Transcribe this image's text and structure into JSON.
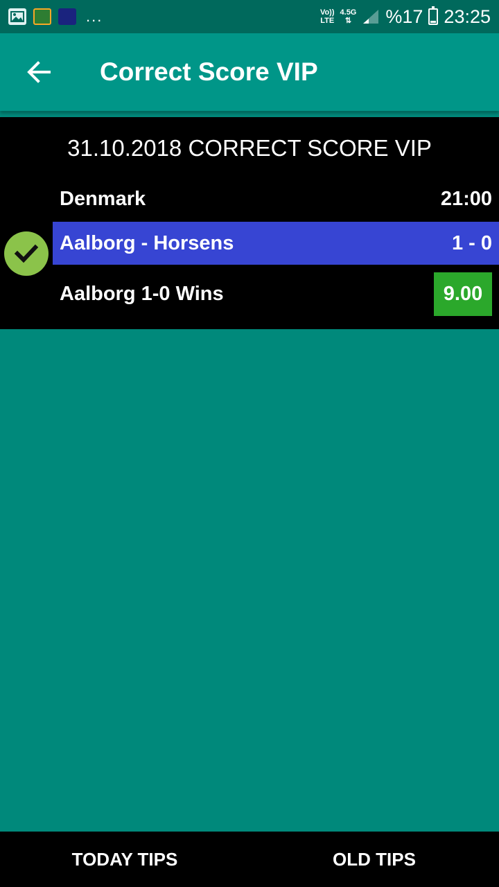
{
  "status_bar": {
    "more_indicator": "...",
    "volte_top": "Vo))",
    "volte_bottom": "LTE",
    "network_top": "4.5G",
    "network_bottom": "⇅",
    "battery_percent": "%17",
    "battery_level": 0.17,
    "time": "23:25"
  },
  "app_bar": {
    "title": "Correct Score VIP",
    "back_icon": "arrow-left-icon"
  },
  "tip": {
    "heading": "31.10.2018 CORRECT SCORE VIP",
    "league": "Denmark",
    "kickoff": "21:00",
    "match": "Aalborg - Horsens",
    "score": "1 - 0",
    "pick": "Aalborg 1-0 Wins",
    "odds": "9.00",
    "result_icon": "check-icon"
  },
  "bottom_nav": {
    "today_label": "TODAY TIPS",
    "old_label": "OLD TIPS"
  },
  "colors": {
    "status_bar": "#00695C",
    "app_bar": "#009688",
    "background": "#00897B",
    "match_row": "#3745D3",
    "odds_badge": "#2BA82B",
    "check_badge": "#8BC34A"
  }
}
